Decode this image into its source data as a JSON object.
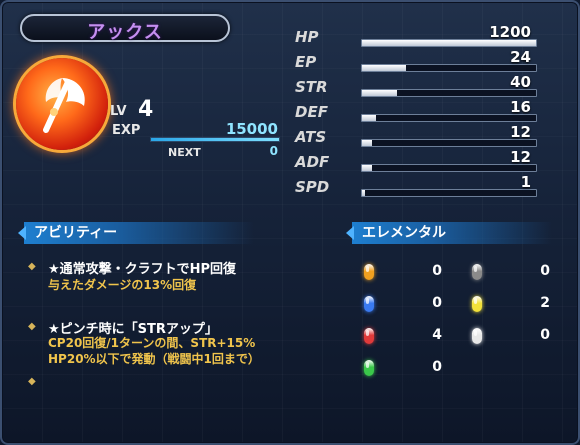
{
  "character": {
    "name": "アックス",
    "element_icon": "axe-emblem-icon"
  },
  "level": {
    "label": "LV",
    "value": "4"
  },
  "exp": {
    "label": "EXP",
    "value": "15000",
    "next_label": "NEXT",
    "next_value": "0",
    "fill_fraction": 1.0
  },
  "stats": [
    {
      "name": "HP",
      "value": "1200",
      "fill_fraction": 1.0
    },
    {
      "name": "EP",
      "value": "24",
      "fill_fraction": 0.25
    },
    {
      "name": "STR",
      "value": "40",
      "fill_fraction": 0.2
    },
    {
      "name": "DEF",
      "value": "16",
      "fill_fraction": 0.08
    },
    {
      "name": "ATS",
      "value": "12",
      "fill_fraction": 0.06
    },
    {
      "name": "ADF",
      "value": "12",
      "fill_fraction": 0.06
    },
    {
      "name": "SPD",
      "value": "1",
      "fill_fraction": 0.02
    }
  ],
  "abilities": {
    "header": "アビリティー",
    "items": [
      {
        "title": "★通常攻撃・クラフトでHP回復",
        "desc": [
          "与えたダメージの13%回復"
        ]
      },
      {
        "title": "★ピンチ時に「STRアップ」",
        "desc": [
          "CP20回復/1ターンの間、STR+15%",
          "HP20%以下で発動（戦闘中1回まで）"
        ]
      }
    ]
  },
  "elementals": {
    "header": "エレメンタル",
    "items": [
      {
        "gem": "earth-orange-gem-icon",
        "color": "#f0a020",
        "value": "0"
      },
      {
        "gem": "time-gray-gem-icon",
        "color": "#8a8a8a",
        "value": "0"
      },
      {
        "gem": "water-blue-gem-icon",
        "color": "#3a7af0",
        "value": "0"
      },
      {
        "gem": "space-yellow-gem-icon",
        "color": "#f2e13a",
        "value": "2"
      },
      {
        "gem": "fire-red-gem-icon",
        "color": "#e03a3a",
        "value": "4"
      },
      {
        "gem": "mirage-white-gem-icon",
        "color": "#e8e8e8",
        "value": "0"
      },
      {
        "gem": "wind-green-gem-icon",
        "color": "#3ac84a",
        "value": "0"
      }
    ]
  }
}
